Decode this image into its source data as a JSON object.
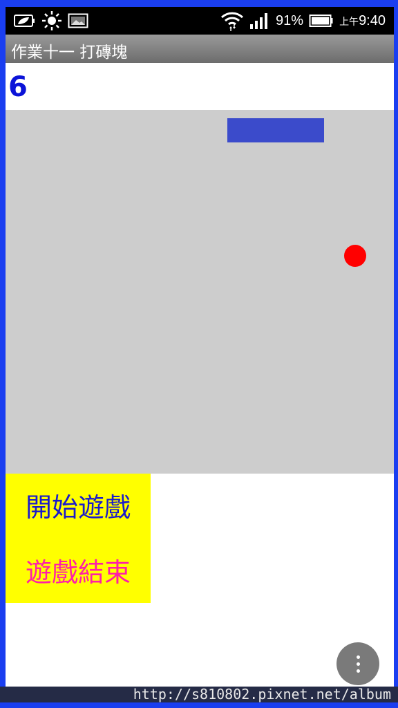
{
  "status_bar": {
    "battery_percent": "91%",
    "time_prefix": "上午",
    "time": "9:40",
    "icons": [
      "leaf-battery-saver-icon",
      "sun-icon",
      "image-icon",
      "wifi-icon",
      "signal-icon",
      "battery-icon"
    ]
  },
  "app": {
    "title": "作業十一 打磚塊"
  },
  "game": {
    "score": "6"
  },
  "controls": {
    "start_label": "開始遊戲",
    "end_label": "遊戲結束"
  },
  "colors": {
    "frame": "#1a3ef0",
    "paddle": "#3b4bcb",
    "ball": "#ff0000",
    "panel": "#ffff00",
    "start_text": "#1a1acc",
    "end_text": "#ff1fa8",
    "score_text": "#0b13d8"
  },
  "watermark": {
    "text": "http://s810802.pixnet.net/album"
  }
}
